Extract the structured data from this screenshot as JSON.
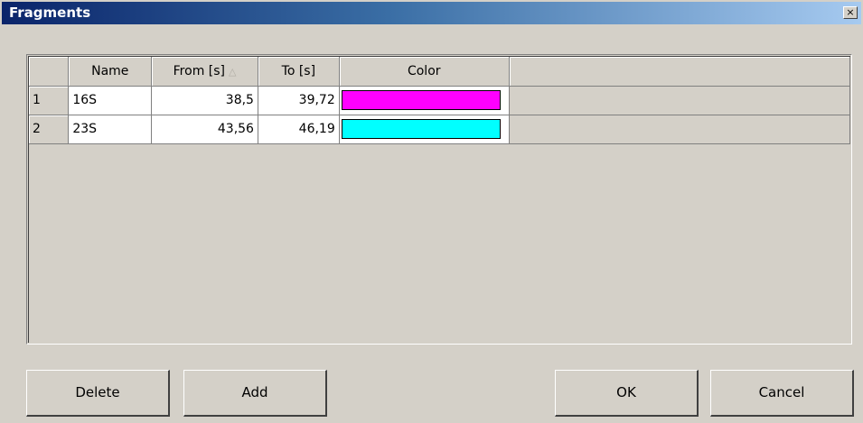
{
  "window": {
    "title": "Fragments",
    "close_label": "×"
  },
  "grid": {
    "columns": [
      "",
      "Name",
      "From [s]",
      "To [s]",
      "Color",
      ""
    ],
    "sort_indicator": "△",
    "rows": [
      {
        "index": "1",
        "name": "16S",
        "from": "38,5",
        "to": "39,72",
        "color": "#ff00ff"
      },
      {
        "index": "2",
        "name": "23S",
        "from": "43,56",
        "to": "46,19",
        "color": "#00ffff"
      }
    ]
  },
  "buttons": {
    "delete": "Delete",
    "add": "Add",
    "ok": "OK",
    "cancel": "Cancel"
  }
}
